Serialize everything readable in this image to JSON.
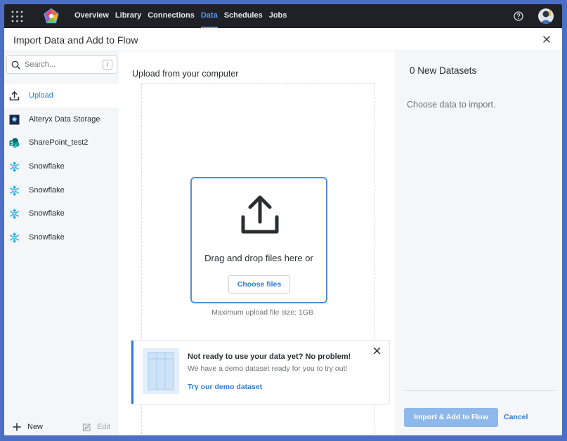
{
  "nav": {
    "links": [
      "Overview",
      "Library",
      "Connections",
      "Data",
      "Schedules",
      "Jobs"
    ],
    "active": "Data"
  },
  "dialog": {
    "title": "Import Data and Add to Flow"
  },
  "sidebar": {
    "search_placeholder": "Search...",
    "search_shortcut": "/",
    "items": [
      {
        "label": "Upload",
        "icon": "upload-icon"
      },
      {
        "label": "Alteryx Data Storage",
        "icon": "alteryx-storage-icon"
      },
      {
        "label": "SharePoint_test2",
        "icon": "sharepoint-icon"
      },
      {
        "label": "Snowflake",
        "icon": "snowflake-icon"
      },
      {
        "label": "Snowflake",
        "icon": "snowflake-icon"
      },
      {
        "label": "Snowflake",
        "icon": "snowflake-icon"
      },
      {
        "label": "Snowflake",
        "icon": "snowflake-icon"
      }
    ],
    "new_label": "New",
    "edit_label": "Edit"
  },
  "upload": {
    "title": "Upload from your computer",
    "drop_text": "Drag and drop files here or",
    "choose_label": "Choose files",
    "max_size": "Maximum upload file size: 1GB"
  },
  "demo": {
    "title": "Not ready to use your data yet? No problem!",
    "subtitle": "We have a demo dataset ready for you to try out!",
    "link": "Try our demo dataset"
  },
  "datasets": {
    "title": "0 New Datasets",
    "hint": "Choose data to import.",
    "import_label": "Import & Add to Flow",
    "cancel_label": "Cancel"
  },
  "colors": {
    "accent": "#2f7bd6",
    "nav_bg": "#1f2126",
    "import_btn": "#8eb8ea"
  }
}
